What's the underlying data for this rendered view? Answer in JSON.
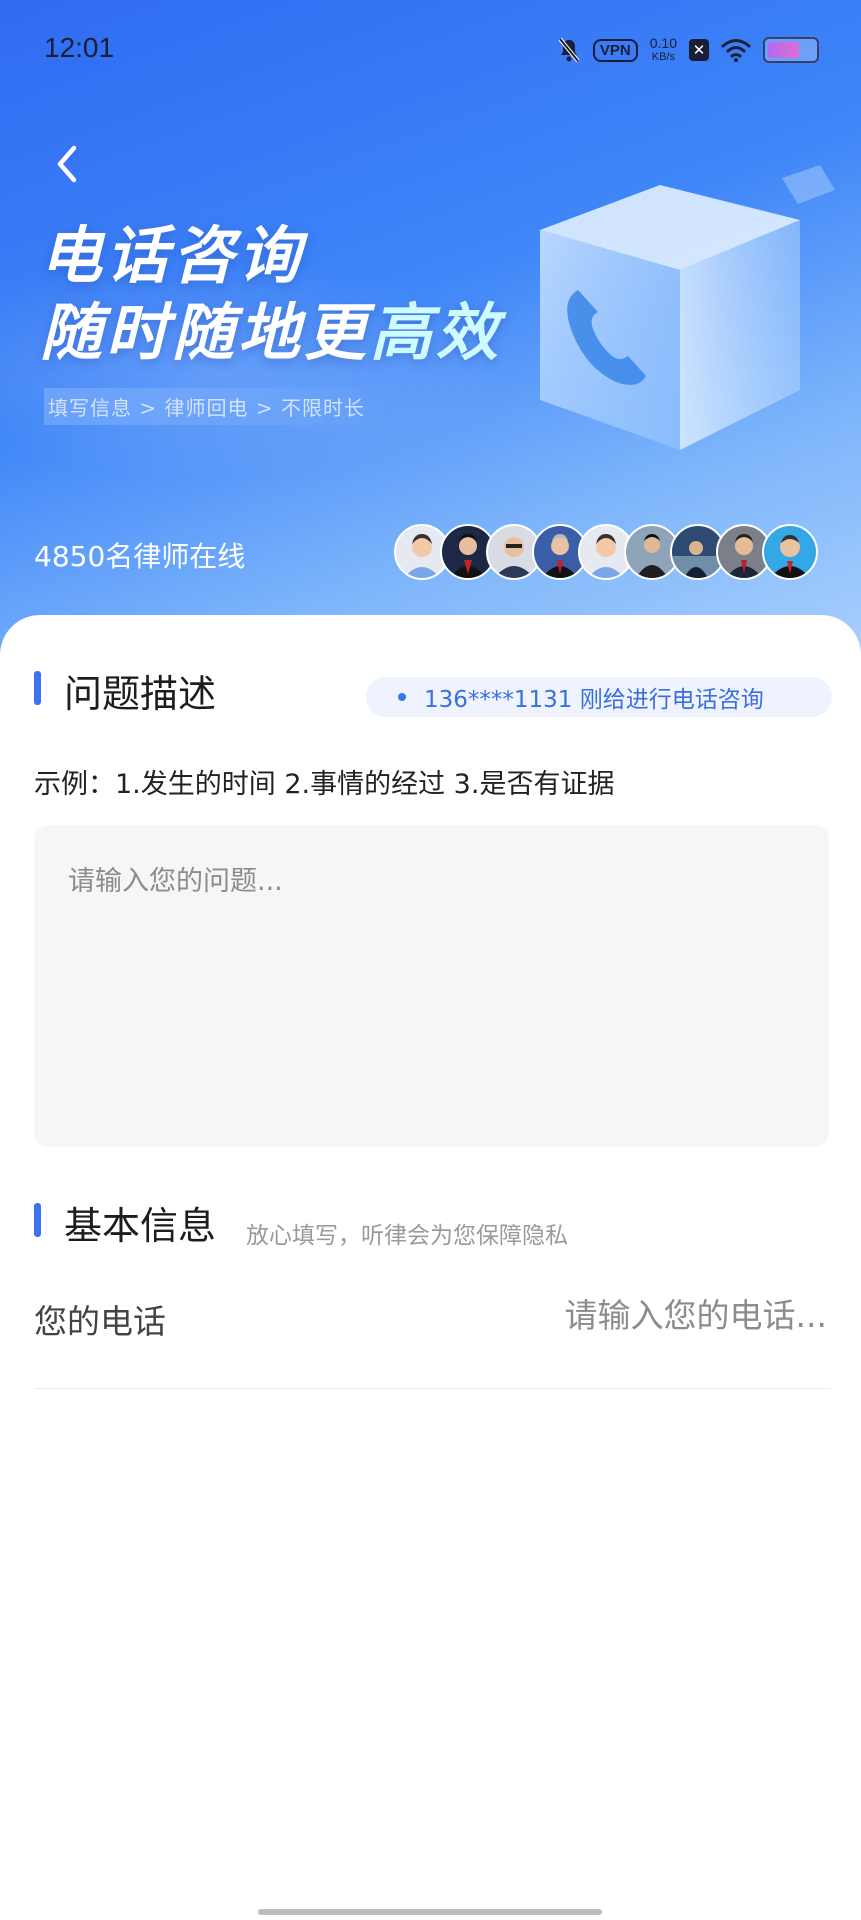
{
  "status_bar": {
    "time": "12:01",
    "vpn": "VPN",
    "speed_value": "0.10",
    "speed_unit": "KB/s",
    "sim_icon_text": "✕"
  },
  "hero": {
    "title_line1": "电话咨询",
    "title_line2_main": "随时随地更",
    "title_line2_highlight": "高效",
    "steps": "填写信息 > 律师回电 > 不限时长",
    "online_lawyers": "4850名律师在线",
    "avatar_count": 9
  },
  "question_section": {
    "title": "问题描述",
    "ticker": "136****1131 刚给进行电话咨询",
    "example": "示例：1.发生的时间 2.事情的经过 3.是否有证据",
    "input_placeholder": "请输入您的问题..."
  },
  "basic_info_section": {
    "title": "基本信息",
    "hint": "放心填写，听律会为您保障隐私",
    "phone_label": "您的电话",
    "phone_placeholder": "请输入您的电话..."
  },
  "colors": {
    "accent": "#3c73ef",
    "hero_gradient_start": "#2f6bf2",
    "hero_gradient_end": "#a9cffc"
  }
}
